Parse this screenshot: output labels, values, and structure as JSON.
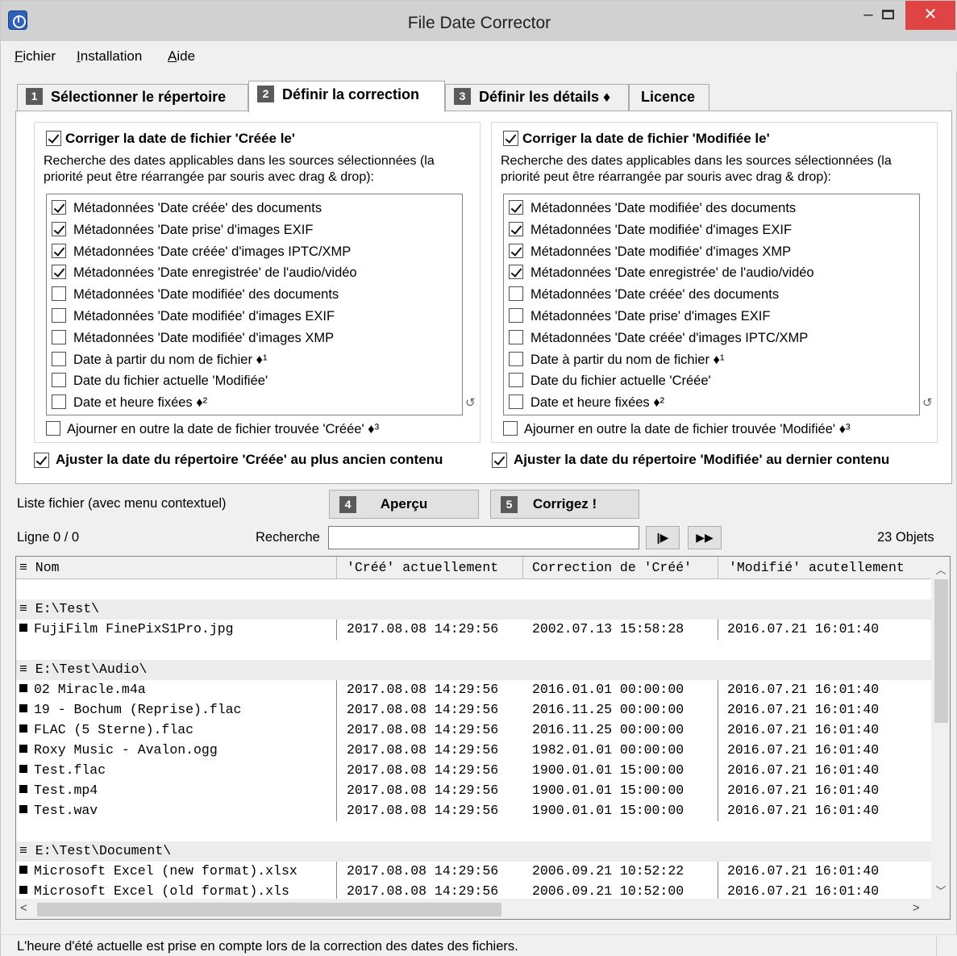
{
  "window": {
    "title": "File Date Corrector",
    "min_glyph": "–",
    "close_glyph": "✕"
  },
  "menu": [
    {
      "label_ul": "F",
      "label_rest": "ichier"
    },
    {
      "label_ul": "I",
      "label_rest": "nstallation"
    },
    {
      "label_ul": "A",
      "label_rest": "ide"
    }
  ],
  "tabs": [
    {
      "num": "1",
      "label": "Sélectionner le répertoire",
      "active": false
    },
    {
      "num": "2",
      "label": "Définir la correction",
      "active": true
    },
    {
      "num": "3",
      "label": "Définir les détails ♦",
      "active": false
    },
    {
      "num": "",
      "label": "Licence",
      "active": false
    }
  ],
  "created_group": {
    "checked": true,
    "heading": "Corriger la date de fichier 'Créée le'",
    "description": "Recherche des dates applicables dans les sources sélectionnées (la priorité peut être réarrangée par souris avec drag & drop):",
    "sources": [
      {
        "label": "Métadonnées 'Date créée' des documents",
        "checked": true
      },
      {
        "label": "Métadonnées 'Date prise' d'images EXIF",
        "checked": true
      },
      {
        "label": "Métadonnées 'Date créée' d'images IPTC/XMP",
        "checked": true
      },
      {
        "label": "Métadonnées 'Date enregistrée' de l'audio/vidéo",
        "checked": true
      },
      {
        "label": "Métadonnées 'Date modifiée' des documents",
        "checked": false
      },
      {
        "label": "Métadonnées 'Date modifiée' d'images EXIF",
        "checked": false
      },
      {
        "label": "Métadonnées 'Date modifiée' d'images XMP",
        "checked": false
      },
      {
        "label": "Date à partir du nom de fichier ♦¹",
        "checked": false
      },
      {
        "label": "Date du fichier actuelle 'Modifiée'",
        "checked": false
      },
      {
        "label": "Date et heure fixées ♦²",
        "checked": false
      }
    ],
    "extra": {
      "label": "Ajourner en outre la date de fichier trouvée 'Créée' ♦³",
      "checked": false
    },
    "dir_adjust": {
      "label": "Ajuster la date du répertoire 'Créée' au plus ancien contenu",
      "checked": true
    }
  },
  "modified_group": {
    "checked": true,
    "heading": "Corriger la date de fichier 'Modifiée le'",
    "description": "Recherche des dates applicables dans les sources sélectionnées (la priorité peut être réarrangée par souris avec drag & drop):",
    "sources": [
      {
        "label": "Métadonnées 'Date modifiée' des documents",
        "checked": true
      },
      {
        "label": "Métadonnées 'Date modifiée' d'images EXIF",
        "checked": true
      },
      {
        "label": "Métadonnées 'Date modifiée' d'images XMP",
        "checked": true
      },
      {
        "label": "Métadonnées 'Date enregistrée' de l'audio/vidéo",
        "checked": true
      },
      {
        "label": "Métadonnées 'Date créée' des documents",
        "checked": false
      },
      {
        "label": "Métadonnées 'Date prise' d'images EXIF",
        "checked": false
      },
      {
        "label": "Métadonnées 'Date créée' d'images IPTC/XMP",
        "checked": false
      },
      {
        "label": "Date à partir du nom de fichier ♦¹",
        "checked": false
      },
      {
        "label": "Date du fichier actuelle 'Créée'",
        "checked": false
      },
      {
        "label": "Date et heure fixées ♦²",
        "checked": false
      }
    ],
    "extra": {
      "label": "Ajourner en outre la date de fichier trouvée 'Modifiée' ♦³",
      "checked": false
    },
    "dir_adjust": {
      "label": "Ajuster la date du répertoire 'Modifiée' au dernier contenu",
      "checked": true
    }
  },
  "controls": {
    "file_list_label": "Liste fichier (avec menu contextuel)",
    "preview_num": "4",
    "preview_label": "Aperçu",
    "correct_num": "5",
    "correct_label": "Corrigez !",
    "line_info": "Ligne 0 / 0",
    "search_label": "Recherche",
    "search_value": "",
    "next_glyph": "|▶",
    "last_glyph": "▶▶",
    "object_count": "23 Objets"
  },
  "file_list": {
    "columns": [
      "≡ Nom",
      "'Créé' actuellement",
      "Correction de 'Créé'",
      "'Modifié' acutellement"
    ],
    "rows": [
      {
        "type": "blank"
      },
      {
        "type": "group",
        "name": "≡ E:\\Test\\"
      },
      {
        "type": "file",
        "name": "FujiFilm FinePixS1Pro.jpg",
        "created": "2017.08.08 14:29:56",
        "correction": "2002.07.13 15:58:28",
        "modified": "2016.07.21 16:01:40"
      },
      {
        "type": "blank"
      },
      {
        "type": "group",
        "name": "≡ E:\\Test\\Audio\\"
      },
      {
        "type": "file",
        "name": "02 Miracle.m4a",
        "created": "2017.08.08 14:29:56",
        "correction": "2016.01.01 00:00:00",
        "modified": "2016.07.21 16:01:40"
      },
      {
        "type": "file",
        "name": "19 - Bochum (Reprise).flac",
        "created": "2017.08.08 14:29:56",
        "correction": "2016.11.25 00:00:00",
        "modified": "2016.07.21 16:01:40"
      },
      {
        "type": "file",
        "name": "FLAC (5 Sterne).flac",
        "created": "2017.08.08 14:29:56",
        "correction": "2016.11.25 00:00:00",
        "modified": "2016.07.21 16:01:40"
      },
      {
        "type": "file",
        "name": "Roxy Music - Avalon.ogg",
        "created": "2017.08.08 14:29:56",
        "correction": "1982.01.01 00:00:00",
        "modified": "2016.07.21 16:01:40"
      },
      {
        "type": "file",
        "name": "Test.flac",
        "created": "2017.08.08 14:29:56",
        "correction": "1900.01.01 15:00:00",
        "modified": "2016.07.21 16:01:40"
      },
      {
        "type": "file",
        "name": "Test.mp4",
        "created": "2017.08.08 14:29:56",
        "correction": "1900.01.01 15:00:00",
        "modified": "2016.07.21 16:01:40"
      },
      {
        "type": "file",
        "name": "Test.wav",
        "created": "2017.08.08 14:29:56",
        "correction": "1900.01.01 15:00:00",
        "modified": "2016.07.21 16:01:40"
      },
      {
        "type": "blank"
      },
      {
        "type": "group",
        "name": "≡ E:\\Test\\Document\\"
      },
      {
        "type": "file",
        "name": "Microsoft Excel (new format).xlsx",
        "created": "2017.08.08 14:29:56",
        "correction": "2006.09.21 10:52:22",
        "modified": "2016.07.21 16:01:40"
      },
      {
        "type": "file",
        "name": "Microsoft Excel (old format).xls",
        "created": "2017.08.08 14:29:56",
        "correction": "2006.09.21 10:52:00",
        "modified": "2016.07.21 16:01:40"
      }
    ]
  },
  "status": {
    "text": "L'heure d'été actuelle est prise en compte lors de la correction des dates des fichiers."
  },
  "icons": {
    "app": "clock-app-icon",
    "reset": "reset-order-icon",
    "scroll_up": "chevron-up-icon",
    "scroll_down": "chevron-down-icon",
    "scroll_left": "chevron-left-icon",
    "scroll_right": "chevron-right-icon"
  },
  "colors": {
    "close_button": "#e04343",
    "titlebar": "#d1d1d1",
    "tab_number_badge": "#5a5a5a"
  }
}
